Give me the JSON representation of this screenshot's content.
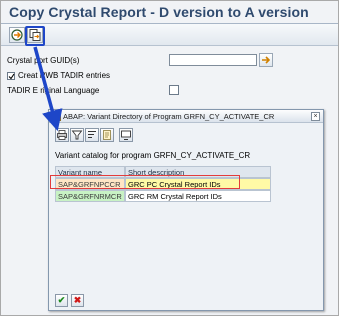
{
  "window": {
    "title": "Copy Crystal Report - D version to A version"
  },
  "toolbar": {
    "execute_icon": "execute-icon",
    "copy_icon": "copy-icon"
  },
  "selection": {
    "guid_label": "Crystal    port GUID(s)",
    "create_label": "Creat    RWB TADIR entries",
    "create_checked": true,
    "tadir_label": "TADIR E    riginal Language",
    "guid_value": ""
  },
  "popup": {
    "title": "ABAP: Variant Directory of Program GRFN_CY_ACTIVATE_CR",
    "catalog_heading": "Variant catalog for program GRFN_CY_ACTIVATE_CR",
    "columns": [
      "Variant name",
      "Short description"
    ],
    "rows": [
      {
        "name": "SAP&GRFNPCCR",
        "description": "GRC PC Crystal Report IDs"
      },
      {
        "name": "SAP&GRFNRMCR",
        "description": "GRC RM Crystal Report IDs"
      }
    ],
    "ok_glyph": "✔",
    "cancel_glyph": "✖",
    "close_glyph": "×"
  },
  "colors": {
    "title": "#2f4a6e",
    "highlight_blue": "#1e46c8",
    "annotation_red": "#e23c3c",
    "row1_name_bg": "#ffe6c5",
    "row1_desc_bg": "#fffaa6",
    "row2_name_bg": "#c8f2c4"
  }
}
